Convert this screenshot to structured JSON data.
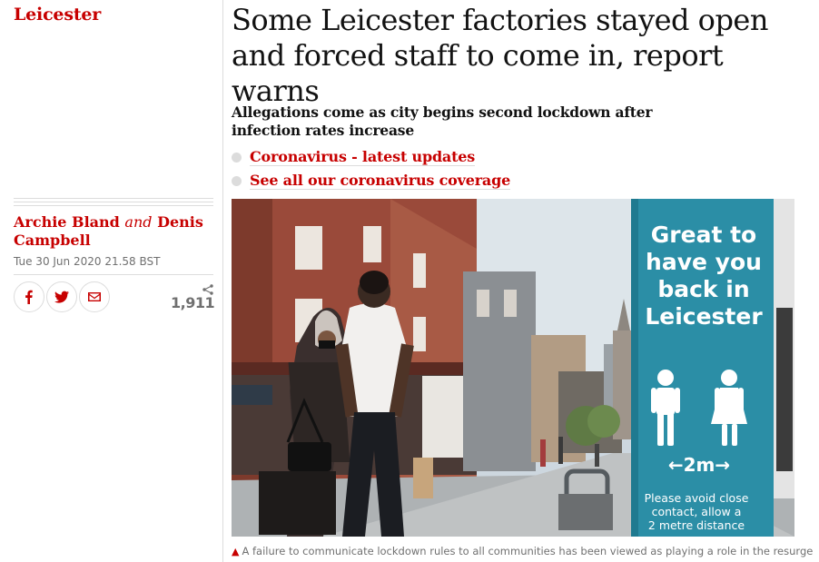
{
  "section": {
    "label": "Leicester"
  },
  "byline": {
    "author1": "Archie Bland",
    "conjunction": "and",
    "author2": "Denis Campbell"
  },
  "dateline": "Tue 30 Jun 2020 21.58 BST",
  "share": {
    "buttons": [
      {
        "name": "facebook",
        "icon": "facebook-icon"
      },
      {
        "name": "twitter",
        "icon": "twitter-icon"
      },
      {
        "name": "email",
        "icon": "email-icon"
      }
    ],
    "count": "1,911",
    "count_icon": "share-icon"
  },
  "headline": "Some Leicester factories stayed open and forced staff to come in, report warns",
  "standfirst": "Allegations come as city begins second lockdown after infection rates increase",
  "related_links": [
    {
      "label": "Coronavirus - latest updates"
    },
    {
      "label": "See all our coronavirus coverage"
    }
  ],
  "photo": {
    "sign_lines": [
      "Great to",
      "have you",
      "back in",
      "Leicester"
    ],
    "sign_distance": "←2m→",
    "sign_notice": [
      "Please avoid close",
      "contact, allow a",
      "2 metre distance"
    ]
  },
  "caption": "A failure to communicate lockdown rules to all communities has been viewed as playing a role in the resurgence",
  "colors": {
    "accent": "#c70000",
    "sign_teal": "#2a8fa6"
  }
}
